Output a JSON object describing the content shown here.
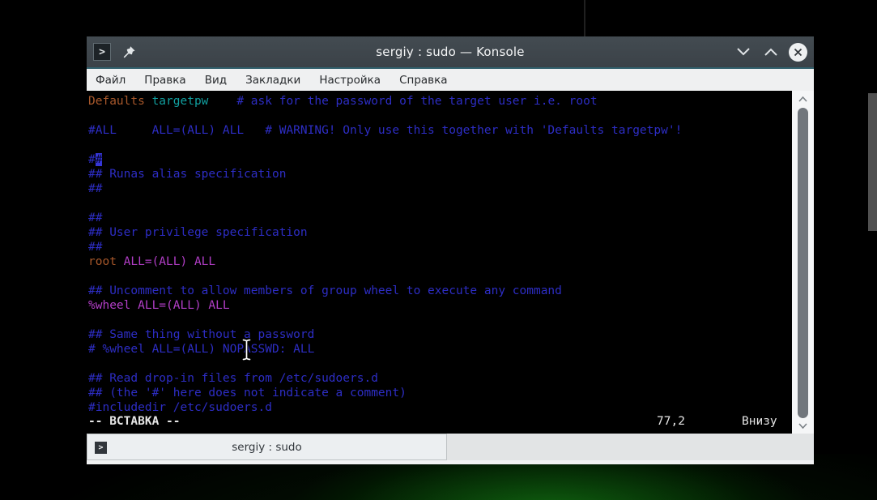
{
  "window": {
    "title": "sergiy : sudo — Konsole",
    "menu_items": [
      "Файл",
      "Правка",
      "Вид",
      "Закладки",
      "Настройка",
      "Справка"
    ],
    "icons": {
      "app_glyph": ">",
      "pin_icon": "push-pin",
      "minimize_icon": "chevron-down",
      "maximize_icon": "chevron-up",
      "close_icon": "x-in-circle"
    },
    "tab": {
      "label": "sergiy : sudo",
      "icon_glyph": ">"
    }
  },
  "terminal": {
    "lines": [
      {
        "segs": [
          {
            "t": "Defaults",
            "c": "stmt"
          },
          {
            "t": " ",
            "c": "plain"
          },
          {
            "t": "targetpw",
            "c": "type"
          },
          {
            "t": "    ",
            "c": "plain"
          },
          {
            "t": "# ask for the password of the target user i.e. root",
            "c": "cmt"
          }
        ]
      },
      {
        "segs": []
      },
      {
        "segs": [
          {
            "t": "#ALL     ALL=(ALL) ALL   # WARNING! Only use this together with 'Defaults targetpw'!",
            "c": "cmt"
          }
        ]
      },
      {
        "segs": []
      },
      {
        "segs": [
          {
            "t": "#",
            "c": "cmt"
          },
          {
            "t": "#",
            "c": "cursor"
          }
        ]
      },
      {
        "segs": [
          {
            "t": "## Runas alias specification",
            "c": "cmt"
          }
        ]
      },
      {
        "segs": [
          {
            "t": "##",
            "c": "cmt"
          }
        ]
      },
      {
        "segs": []
      },
      {
        "segs": [
          {
            "t": "##",
            "c": "cmt"
          }
        ]
      },
      {
        "segs": [
          {
            "t": "## User privilege specification",
            "c": "cmt"
          }
        ]
      },
      {
        "segs": [
          {
            "t": "##",
            "c": "cmt"
          }
        ]
      },
      {
        "segs": [
          {
            "t": "root",
            "c": "stmt"
          },
          {
            "t": " ",
            "c": "plain"
          },
          {
            "t": "ALL=(ALL) ALL",
            "c": "id"
          }
        ]
      },
      {
        "segs": []
      },
      {
        "segs": [
          {
            "t": "## Uncomment to allow members of group wheel to execute any command",
            "c": "cmt"
          }
        ]
      },
      {
        "segs": [
          {
            "t": "%wheel ALL=(ALL) ALL",
            "c": "id"
          }
        ]
      },
      {
        "segs": []
      },
      {
        "segs": [
          {
            "t": "## Same thing without a password",
            "c": "cmt"
          }
        ]
      },
      {
        "segs": [
          {
            "t": "# %wheel ALL=(ALL) NOPASSWD: ALL",
            "c": "cmt"
          }
        ]
      },
      {
        "segs": []
      },
      {
        "segs": [
          {
            "t": "## Read drop-in files from /etc/sudoers.d",
            "c": "cmt"
          }
        ]
      },
      {
        "segs": [
          {
            "t": "## (the '#' here does not indicate a comment)",
            "c": "cmt"
          }
        ]
      },
      {
        "segs": [
          {
            "t": "#includedir /etc/sudoers.d",
            "c": "cmt"
          }
        ]
      }
    ],
    "status": {
      "mode": "-- ВСТАВКА --",
      "position": "77,2",
      "scroll": "Внизу"
    }
  },
  "colors": {
    "titlebar_bg": "#3b4248",
    "titlebar_fg": "#eff0f1",
    "accent_line": "#31606c",
    "menubar_bg": "#eff0f1",
    "menubar_fg": "#26292c",
    "terminal_bg": "#000000",
    "comment": "#2d2dc4",
    "statement": "#a8582b",
    "type": "#119f9f",
    "identifier": "#b23ec7",
    "cursor_bg": "#3636d8",
    "status_fg": "#e6e6e6",
    "scrollbar_thumb": "#71767c",
    "scrollbar_track": "#f5f6f7",
    "tabbar_bg": "#e2e4e5",
    "tab_bg": "#eceff1",
    "tab_fg": "#31363b"
  }
}
